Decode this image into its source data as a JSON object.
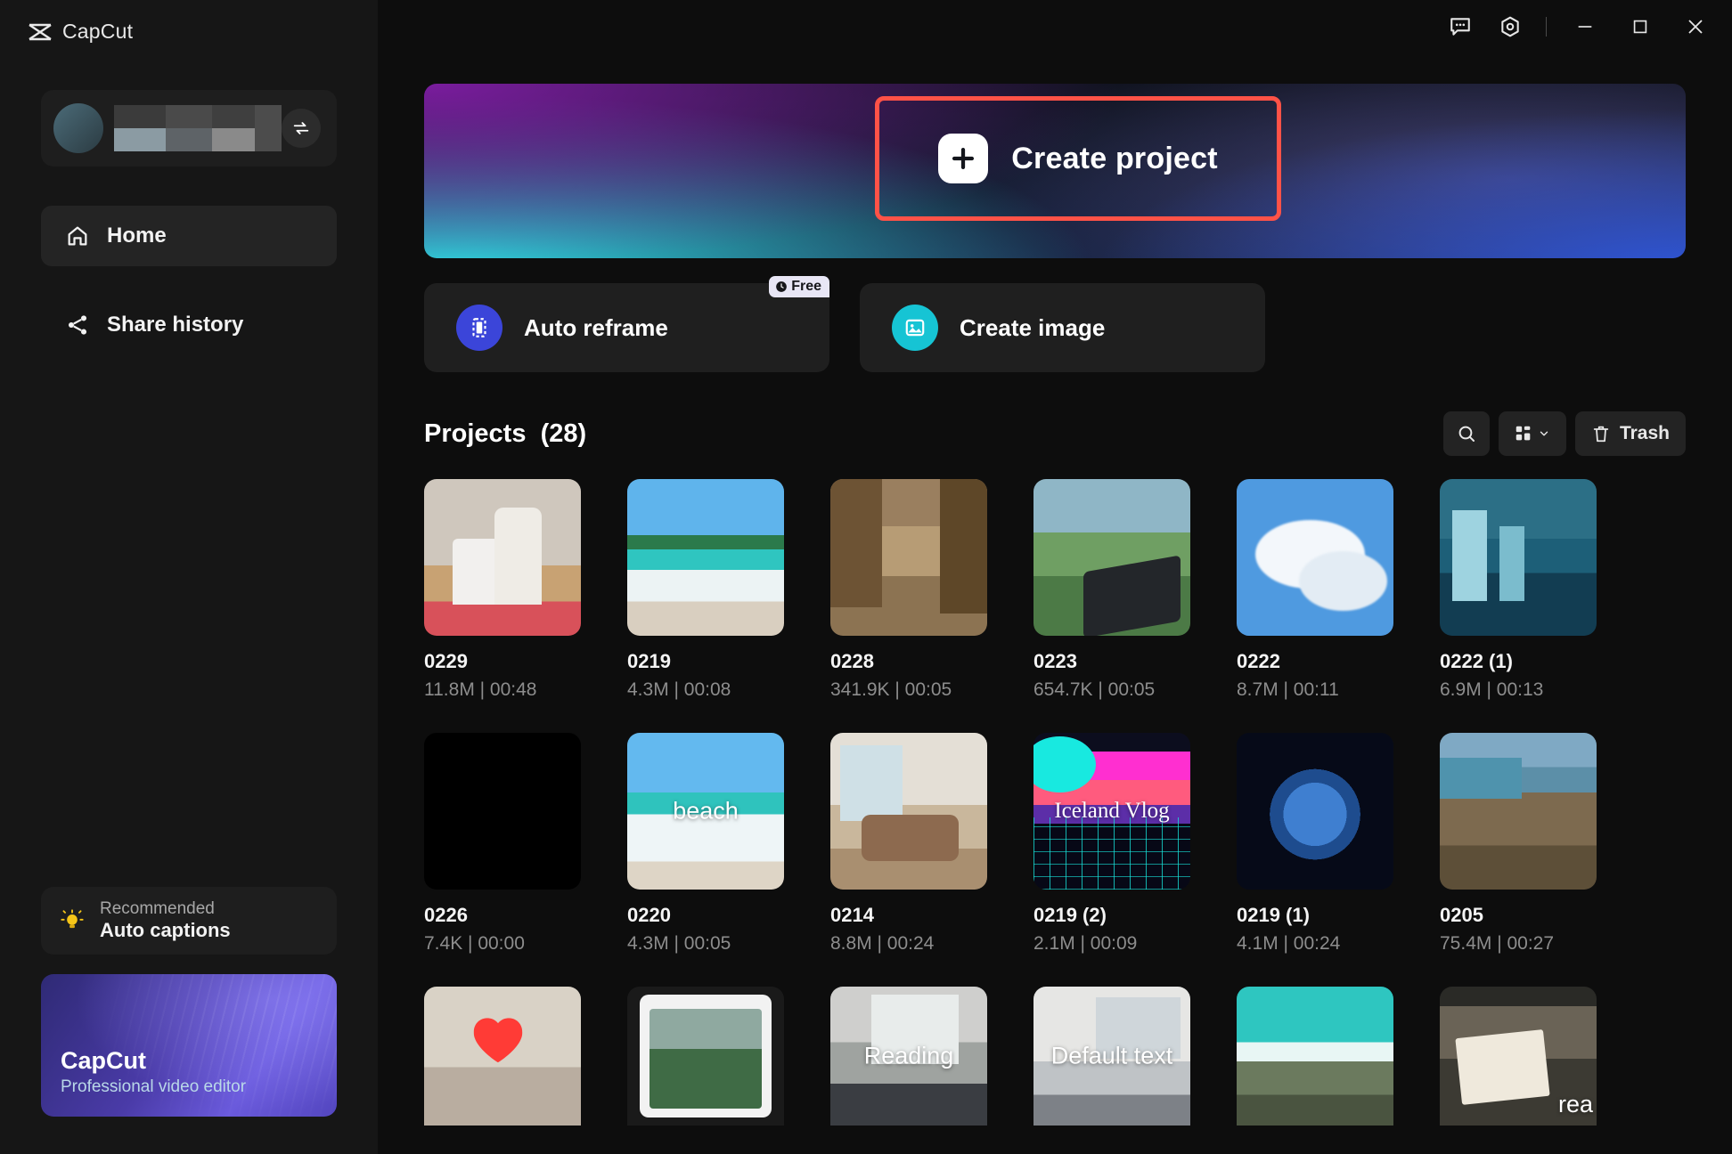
{
  "app": {
    "name": "CapCut",
    "logo_icon": "capcut-logo-icon"
  },
  "titlebar": {
    "feedback_icon": "feedback-chat-icon",
    "settings_icon": "settings-hex-icon",
    "minimize_icon": "minimize-icon",
    "maximize_icon": "maximize-icon",
    "close_icon": "close-icon"
  },
  "sidebar": {
    "profile": {
      "swap_icon": "account-switch-icon",
      "name_masked": true
    },
    "items": [
      {
        "label": "Home",
        "icon": "home-icon",
        "active": true
      },
      {
        "label": "Share history",
        "icon": "share-icon",
        "active": false
      }
    ],
    "recommended": {
      "eyebrow": "Recommended",
      "title": "Auto captions",
      "icon": "lightbulb-icon"
    },
    "promo": {
      "title": "CapCut",
      "subtitle": "Professional video editor"
    }
  },
  "banner": {
    "create_project_label": "Create project",
    "plus_icon": "plus-icon",
    "highlight_color": "#ff5247"
  },
  "quick_actions": [
    {
      "label": "Auto reframe",
      "icon": "auto-reframe-icon",
      "icon_color": "#3b45d9",
      "badge": "Free",
      "badge_icon": "clock-icon"
    },
    {
      "label": "Create image",
      "icon": "create-image-icon",
      "icon_color": "#16c4d4",
      "badge": ""
    }
  ],
  "projects": {
    "title": "Projects",
    "count_label": "(28)",
    "tools": {
      "search_icon": "search-icon",
      "view_icon": "grid-view-icon",
      "view_chevron": "chevron-down-icon",
      "trash_label": "Trash",
      "trash_icon": "trash-icon"
    },
    "rows": [
      [
        {
          "name": "0229",
          "meta": "11.8M | 00:48",
          "art": "t-xmas",
          "overlay": ""
        },
        {
          "name": "0219",
          "meta": "4.3M | 00:08",
          "art": "t-beach1",
          "overlay": ""
        },
        {
          "name": "0228",
          "meta": "341.9K | 00:05",
          "art": "t-street",
          "overlay": ""
        },
        {
          "name": "0223",
          "meta": "654.7K | 00:05",
          "art": "t-game",
          "overlay": ""
        },
        {
          "name": "0222",
          "meta": "8.7M | 00:11",
          "art": "t-clouds",
          "overlay": ""
        },
        {
          "name": "0222 (1)",
          "meta": "6.9M | 00:13",
          "art": "t-city",
          "overlay": ""
        }
      ],
      [
        {
          "name": "0226",
          "meta": "7.4K | 00:00",
          "art": "t-black",
          "overlay": ""
        },
        {
          "name": "0220",
          "meta": "4.3M | 00:05",
          "art": "t-beach2",
          "overlay": "beach"
        },
        {
          "name": "0214",
          "meta": "8.8M | 00:24",
          "art": "t-room",
          "overlay": ""
        },
        {
          "name": "0219 (2)",
          "meta": "2.1M | 00:09",
          "art": "t-vlog",
          "overlay": "Iceland Vlog"
        },
        {
          "name": "0219 (1)",
          "meta": "4.1M | 00:24",
          "art": "t-earth",
          "overlay": ""
        },
        {
          "name": "0205",
          "meta": "75.4M | 00:27",
          "art": "t-coast",
          "overlay": ""
        }
      ],
      [
        {
          "name": "",
          "meta": "",
          "art": "t-desk",
          "overlay": ""
        },
        {
          "name": "",
          "meta": "",
          "art": "t-tablet",
          "overlay": ""
        },
        {
          "name": "",
          "meta": "",
          "art": "t-present",
          "overlay": "Reading"
        },
        {
          "name": "",
          "meta": "",
          "art": "t-class",
          "overlay": "Default text"
        },
        {
          "name": "",
          "meta": "",
          "art": "t-ocean",
          "overlay": ""
        },
        {
          "name": "",
          "meta": "",
          "art": "t-book",
          "overlay": "rea"
        }
      ]
    ]
  }
}
